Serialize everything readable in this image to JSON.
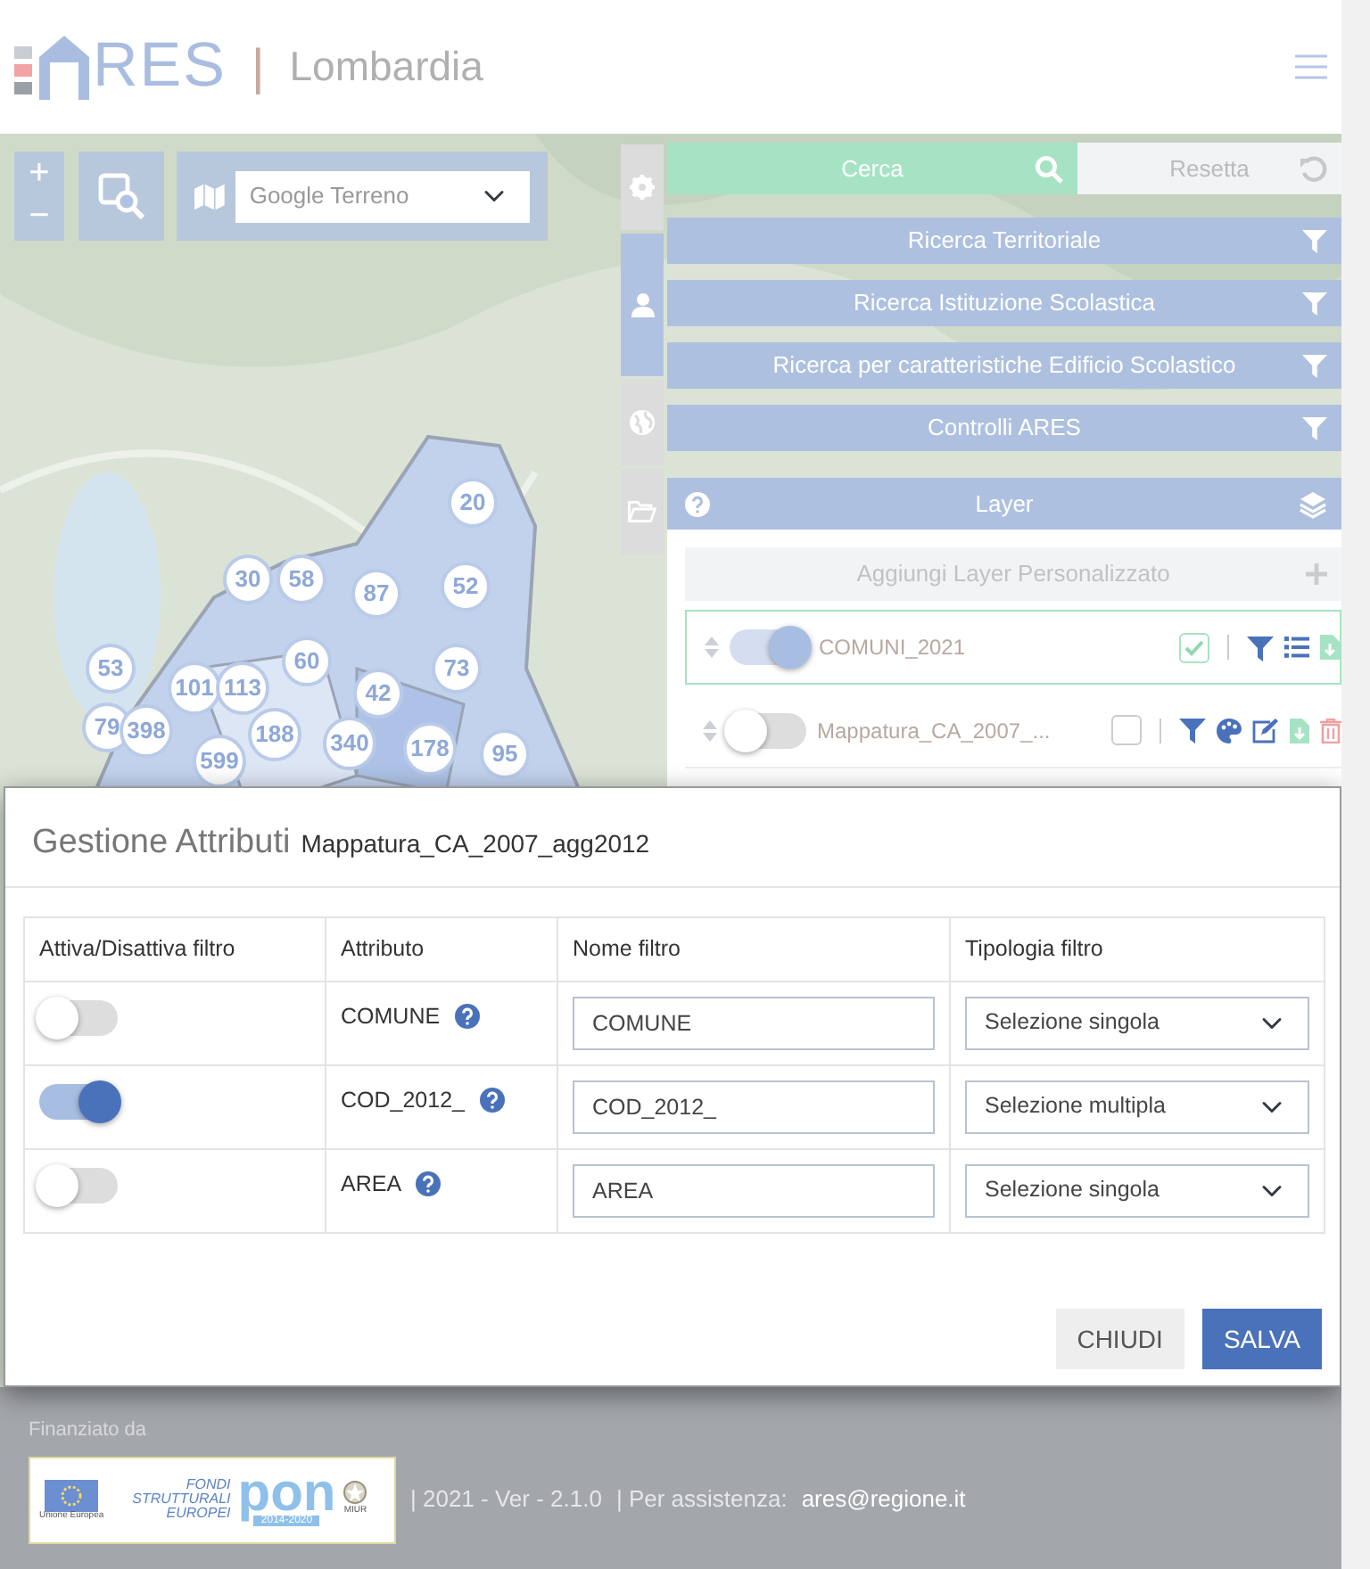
{
  "header": {
    "logo_text": "RES",
    "separator": "|",
    "region": "Lombardia"
  },
  "map": {
    "zoom_in": "+",
    "zoom_out": "−",
    "base_layer": "Google Terreno",
    "clusters": [
      {
        "label": "20"
      },
      {
        "label": "30"
      },
      {
        "label": "58"
      },
      {
        "label": "87"
      },
      {
        "label": "52"
      },
      {
        "label": "53"
      },
      {
        "label": "101"
      },
      {
        "label": "113"
      },
      {
        "label": "60"
      },
      {
        "label": "73"
      },
      {
        "label": "42"
      },
      {
        "label": "79"
      },
      {
        "label": "398"
      },
      {
        "label": "188"
      },
      {
        "label": "340"
      },
      {
        "label": "178"
      },
      {
        "label": "95"
      },
      {
        "label": "599"
      }
    ]
  },
  "side_tabs": [
    {
      "kind": "settings",
      "selected": false
    },
    {
      "kind": "user",
      "selected": true
    },
    {
      "kind": "globe",
      "selected": false
    },
    {
      "kind": "folder",
      "selected": false
    }
  ],
  "search": {
    "search_button": "Cerca",
    "reset_button": "Resetta"
  },
  "filter_sections": [
    "Ricerca Territoriale",
    "Ricerca Istituzione Scolastica",
    "Ricerca per caratteristiche Edificio Scolastico",
    "Controlli ARES"
  ],
  "layer_panel": {
    "title": "Layer",
    "add_button": "Aggiungi Layer Personalizzato",
    "layers": [
      {
        "name": "COMUNI_2021",
        "on": true,
        "checked": true,
        "selected": true,
        "tools": [
          {
            "kind": "filter"
          },
          {
            "kind": "list"
          },
          {
            "kind": "download"
          }
        ]
      },
      {
        "name": "Mappatura_CA_2007_...",
        "on": false,
        "checked": false,
        "selected": false,
        "tools": [
          {
            "kind": "filter"
          },
          {
            "kind": "palette"
          },
          {
            "kind": "edit"
          },
          {
            "kind": "download"
          },
          {
            "kind": "delete"
          }
        ]
      }
    ]
  },
  "modal": {
    "title": "Gestione Attributi",
    "subtitle": "Mappatura_CA_2007_agg2012",
    "columns": [
      "Attiva/Disattiva filtro",
      "Attributo",
      "Nome filtro",
      "Tipologia filtro"
    ],
    "rows": [
      {
        "on": false,
        "attribute": "COMUNE",
        "filter_name": "COMUNE",
        "filter_type": "Selezione singola"
      },
      {
        "on": true,
        "attribute": "COD_2012_",
        "filter_name": "COD_2012_",
        "filter_type": "Selezione multipla"
      },
      {
        "on": false,
        "attribute": "AREA",
        "filter_name": "AREA",
        "filter_type": "Selezione singola"
      }
    ],
    "buttons": [
      {
        "label": "CHIUDI",
        "kind": "secondary"
      },
      {
        "label": "SALVA",
        "kind": "primary"
      }
    ]
  },
  "footer": {
    "funded_by": "Finanziato da",
    "funding_logo": {
      "eu": "Unione Europea",
      "funds": [
        "FONDI",
        "STRUTTURALI",
        "EUROPEI"
      ],
      "program": "pon",
      "years": "2014-2020",
      "ministry": "MIUR"
    },
    "version": "| 2021 - Ver - 2.1.0",
    "assistance": "| Per assistenza:",
    "email": "ares@regione.it"
  }
}
